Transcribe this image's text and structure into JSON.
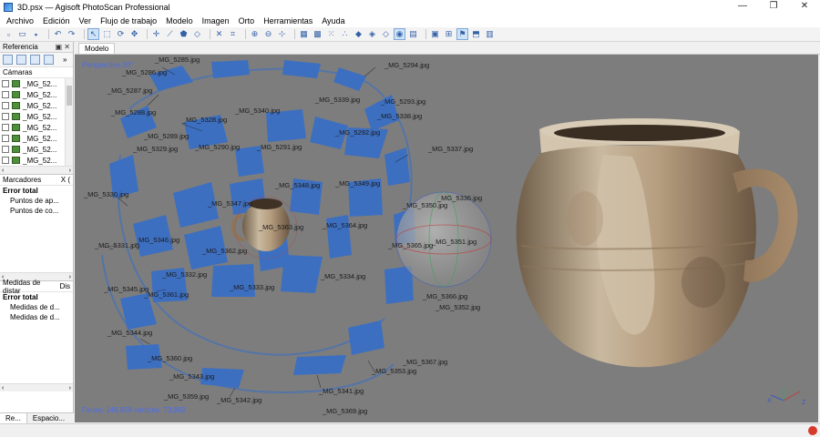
{
  "window": {
    "title": "3D.psx — Agisoft PhotoScan Professional",
    "controls": {
      "minimize": "—",
      "maximize": "❐",
      "close": "✕"
    }
  },
  "menu": [
    "Archivo",
    "Edición",
    "Ver",
    "Flujo de trabajo",
    "Modelo",
    "Imagen",
    "Orto",
    "Herramientas",
    "Ayuda"
  ],
  "reference_panel": {
    "title": "Referencia",
    "cameras_header": "Cámaras",
    "cameras": [
      "_MG_52...",
      "_MG_52...",
      "_MG_52...",
      "_MG_52...",
      "_MG_52...",
      "_MG_52...",
      "_MG_52...",
      "_MG_52..."
    ],
    "markers_header": "Marcadores",
    "markers_col": "X (",
    "error_total": "Error total",
    "marker_rows": [
      "Puntos de ap...",
      "Puntos de co..."
    ],
    "measures_header": "Medidas de distar",
    "measures_col2": "Dis",
    "measure_rows": [
      "Medidas de d...",
      "Medidas de d..."
    ]
  },
  "bottom_tabs": [
    "Re...",
    "Espacio..."
  ],
  "model_tab": "Modelo",
  "viewport": {
    "perspective": "Perspective 30°",
    "stats": "Faces: 146,858 vertices: 73,962"
  },
  "camera_labels": [
    "_MG_5285.jpg",
    "_MG_5286.jpg",
    "_MG_5287.jpg",
    "_MG_5288.jpg",
    "_MG_5289.jpg",
    "_MG_5290.jpg",
    "_MG_5291.jpg",
    "_MG_5292.jpg",
    "_MG_5293.jpg",
    "_MG_5294.jpg",
    "_MG_5328.jpg",
    "_MG_5329.jpg",
    "_MG_5330.jpg",
    "_MG_5331.jpg",
    "_MG_5332.jpg",
    "_MG_5333.jpg",
    "_MG_5334.jpg",
    "_MG_5336.jpg",
    "_MG_5337.jpg",
    "_MG_5338.jpg",
    "_MG_5339.jpg",
    "_MG_5340.jpg",
    "_MG_5341.jpg",
    "_MG_5342.jpg",
    "_MG_5343.jpg",
    "_MG_5344.jpg",
    "_MG_5345.jpg",
    "_MG_5346.jpg",
    "_MG_5347.jpg",
    "_MG_5348.jpg",
    "_MG_5349.jpg",
    "_MG_5350.jpg",
    "_MG_5351.jpg",
    "_MG_5352.jpg",
    "_MG_5353.jpg",
    "_MG_5359.jpg",
    "_MG_5360.jpg",
    "_MG_5361.jpg",
    "_MG_5362.jpg",
    "_MG_5363.jpg",
    "_MG_5364.jpg",
    "_MG_5365.jpg",
    "_MG_5366.jpg",
    "_MG_5367.jpg",
    "_MG_5369.jpg"
  ],
  "colors": {
    "camera_plane": "#3a6fc4",
    "viewport_bg": "#7d7d7d",
    "overlay_text": "#4a6cf0"
  }
}
